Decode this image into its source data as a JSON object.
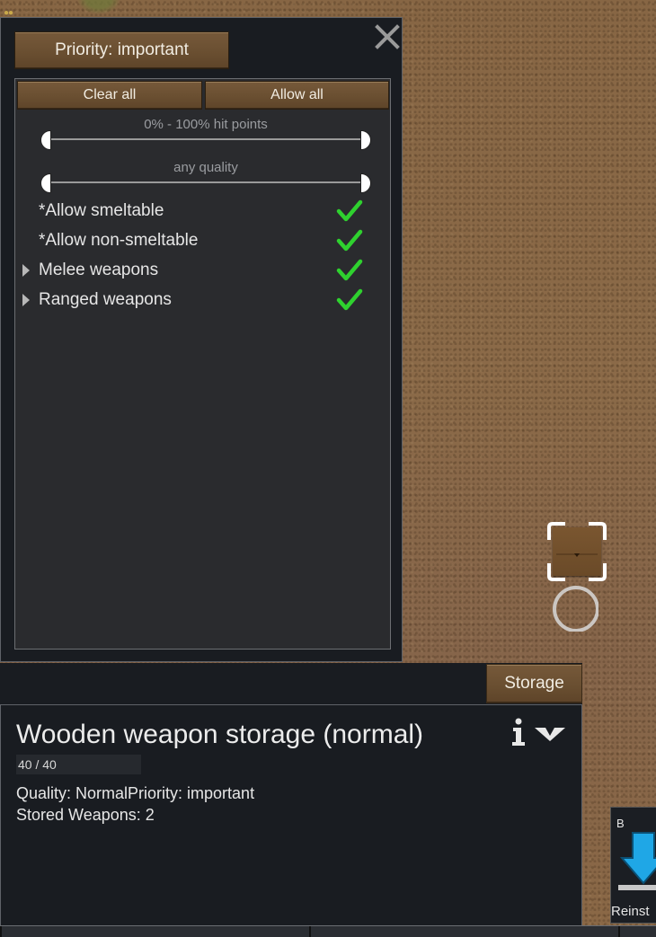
{
  "filter_panel": {
    "priority_label": "Priority: important",
    "clear_all_label": "Clear all",
    "allow_all_label": "Allow all",
    "hitpoints_slider_label": "0% - 100% hit points",
    "quality_slider_label": "any quality",
    "rows": [
      {
        "label": "*Allow smeltable",
        "checked": true,
        "expandable": false
      },
      {
        "label": "*Allow non-smeltable",
        "checked": true,
        "expandable": false
      },
      {
        "label": "Melee weapons",
        "checked": true,
        "expandable": true
      },
      {
        "label": "Ranged weapons",
        "checked": true,
        "expandable": true
      }
    ],
    "check_color": "#2fd12f"
  },
  "inspect": {
    "tab_label": "Storage",
    "title": "Wooden weapon storage (normal)",
    "hitpoints": "40 / 40",
    "quality_line": "Quality: NormalPriority: important",
    "stored_line": "Stored Weapons: 2"
  },
  "gizmo": {
    "hotkey": "B",
    "label": "Reinst"
  },
  "icons": [
    "close-icon",
    "info-icon",
    "collapse-icon",
    "checkmark-icon",
    "expand-arrow-icon",
    "reinstall-icon"
  ]
}
